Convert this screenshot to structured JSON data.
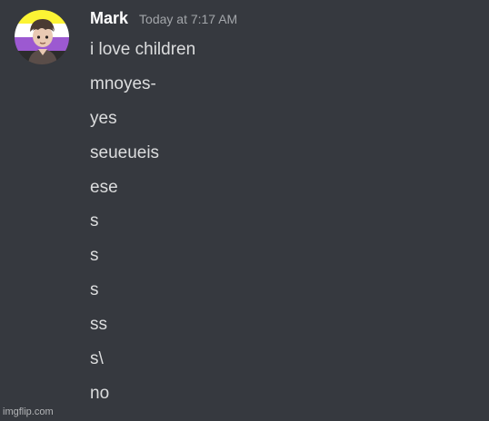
{
  "message": {
    "author": "Mark",
    "timestamp": "Today at 7:17 AM",
    "lines": [
      "i love children",
      "mnoyes-",
      "yes",
      "seueueis",
      "ese",
      "s",
      "s",
      "s",
      "ss",
      "s\\",
      "no"
    ]
  },
  "avatar": {
    "icon": "avatar-nonbinary-flag",
    "flag_colors": [
      "#fcf434",
      "#ffffff",
      "#9c59d1",
      "#2c2c2c"
    ]
  },
  "colors": {
    "background": "#36393f",
    "username": "#ffffff",
    "timestamp": "#a3a6aa",
    "text": "#dcddde"
  },
  "watermark": "imgflip.com"
}
